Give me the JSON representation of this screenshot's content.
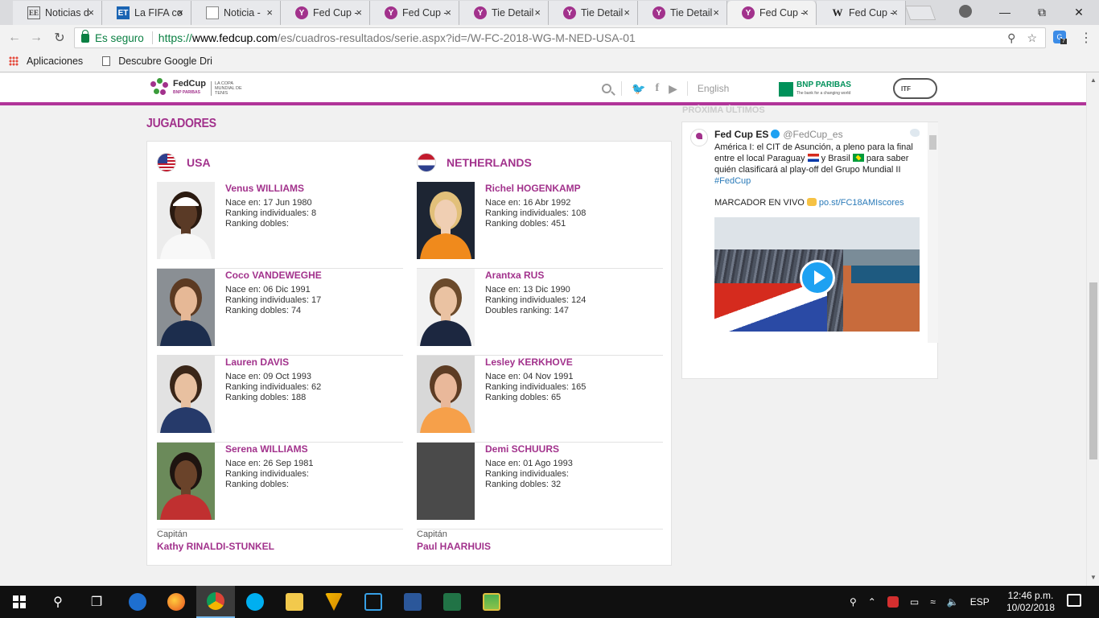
{
  "browser": {
    "tabs": [
      {
        "favicon": "ee",
        "title": "Noticias d"
      },
      {
        "favicon": "et",
        "title": "La FIFA co"
      },
      {
        "favicon": "doc",
        "title": "Noticia -"
      },
      {
        "favicon": "fc",
        "title": "Fed Cup -"
      },
      {
        "favicon": "fc",
        "title": "Fed Cup -"
      },
      {
        "favicon": "fc",
        "title": "Tie Detail"
      },
      {
        "favicon": "fc",
        "title": "Tie Detail"
      },
      {
        "favicon": "fc",
        "title": "Tie Detail"
      },
      {
        "favicon": "fc",
        "title": "Fed Cup -"
      },
      {
        "favicon": "w",
        "title": "Fed Cup -"
      }
    ],
    "active_tab": 8,
    "close_glyph": "×",
    "security_label": "Es seguro",
    "url_scheme": "https://",
    "url_host": "www.fedcup.com",
    "url_path": "/es/cuadros-resultados/serie.aspx?id=/W-FC-2018-WG-M-NED-USA-01",
    "extension_badge": "7",
    "bookmarks": {
      "apps_label": "Aplicaciones",
      "item_label": "Descubre Google Dri"
    }
  },
  "site": {
    "lang_label": "English",
    "logo_word": "FedCup",
    "logo_sub": "BNP PARIBAS",
    "logo_tag": "LA COPA MUNDIAL DE TENIS",
    "sponsor_name": "BNP PARIBAS",
    "sponsor_tag": "The bank for a changing world",
    "itf_label": "ITF",
    "side_headers_cut": "PRÓXIMA           ÚLTIMOS"
  },
  "players_section": {
    "title": "JUGADORES",
    "teams": [
      {
        "name": "USA",
        "flag": "usa",
        "players": [
          {
            "name": "Venus WILLIAMS",
            "born": "Nace en: 17 Jun 1980",
            "singles": "Ranking individuales: 8",
            "doubles": "Ranking dobles:",
            "photo": "venus"
          },
          {
            "name": "Coco VANDEWEGHE",
            "born": "Nace en: 06 Dic 1991",
            "singles": "Ranking individuales: 17",
            "doubles": "Ranking dobles: 74",
            "photo": "coco"
          },
          {
            "name": "Lauren DAVIS",
            "born": "Nace en: 09 Oct 1993",
            "singles": "Ranking individuales: 62",
            "doubles": "Ranking dobles: 188",
            "photo": "lauren"
          },
          {
            "name": "Serena WILLIAMS",
            "born": "Nace en: 26 Sep 1981",
            "singles": "Ranking individuales:",
            "doubles": "Ranking dobles:",
            "photo": "serena"
          }
        ],
        "captain_label": "Capitán",
        "captain_name": "Kathy RINALDI-STUNKEL"
      },
      {
        "name": "NETHERLANDS",
        "flag": "ned",
        "players": [
          {
            "name": "Richel HOGENKAMP",
            "born": "Nace en: 16 Abr 1992",
            "singles": "Ranking individuales: 108",
            "doubles": "Ranking dobles: 451",
            "photo": "richel"
          },
          {
            "name": "Arantxa RUS",
            "born": "Nace en: 13 Dic 1990",
            "singles": "Ranking individuales: 124",
            "doubles": "Doubles ranking: 147",
            "photo": "arantxa"
          },
          {
            "name": "Lesley KERKHOVE",
            "born": "Nace en: 04 Nov 1991",
            "singles": "Ranking individuales: 165",
            "doubles": "Ranking dobles: 65",
            "photo": "lesley"
          },
          {
            "name": "Demi SCHUURS",
            "born": "Nace en: 01 Ago 1993",
            "singles": "Ranking individuales:",
            "doubles": "Ranking dobles: 32",
            "photo": "none"
          }
        ],
        "captain_label": "Capitán",
        "captain_name": "Paul HAARHUIS"
      }
    ]
  },
  "twitter": {
    "name": "Fed Cup ES",
    "handle": "@FedCup_es",
    "text_1": "América I: el CIT de Asunción, a pleno para la final entre el local Paraguay",
    "text_2": "y Brasil",
    "text_3": "para saber quién clasificará al play-off del Grupo Mundial II",
    "hashtag": "#FedCup",
    "live_label": "MARCADOR EN VIVO",
    "live_link": "po.st/FC18AMIscores"
  },
  "taskbar": {
    "language": "ESP",
    "time": "12:46 p.m.",
    "date": "10/02/2018"
  },
  "colors": {
    "brand": "#a2328c",
    "twitter_blue": "#1da1f2"
  }
}
